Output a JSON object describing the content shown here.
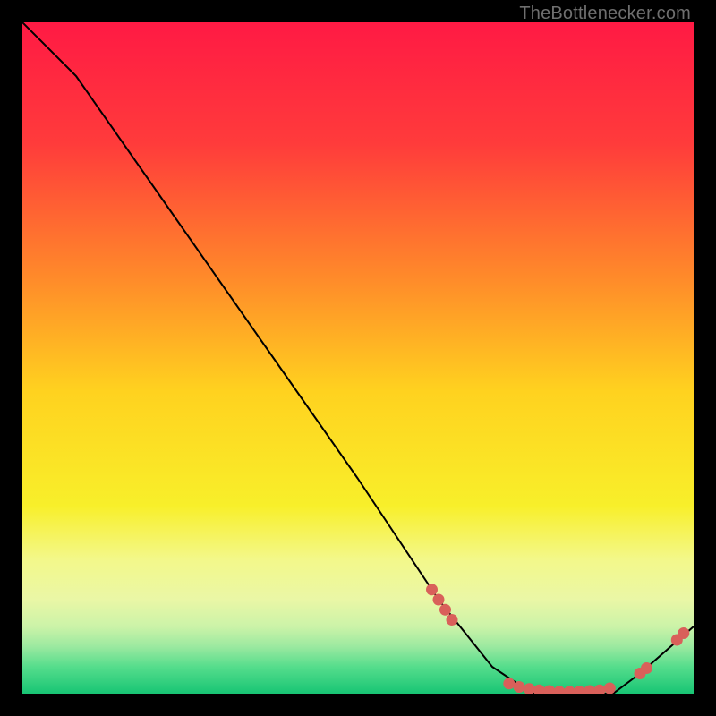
{
  "attribution": "TheBottlenecker.com",
  "chart_data": {
    "type": "line",
    "title": "",
    "xlabel": "",
    "ylabel": "",
    "xlim": [
      0,
      100
    ],
    "ylim": [
      0,
      100
    ],
    "grid": false,
    "legend": false,
    "series": [
      {
        "name": "curve",
        "x": [
          0,
          8,
          22,
          36,
          50,
          62,
          70,
          76,
          82,
          88,
          92,
          100
        ],
        "y": [
          100,
          92,
          72,
          52,
          32,
          14,
          4,
          0,
          0,
          0,
          3,
          10
        ]
      }
    ],
    "markers": {
      "name": "red-dots",
      "points": [
        {
          "x": 61.0,
          "y": 15.5
        },
        {
          "x": 62.0,
          "y": 14.0
        },
        {
          "x": 63.0,
          "y": 12.5
        },
        {
          "x": 64.0,
          "y": 11.0
        },
        {
          "x": 72.5,
          "y": 1.5
        },
        {
          "x": 74.0,
          "y": 1.0
        },
        {
          "x": 75.5,
          "y": 0.7
        },
        {
          "x": 77.0,
          "y": 0.5
        },
        {
          "x": 78.5,
          "y": 0.4
        },
        {
          "x": 80.0,
          "y": 0.3
        },
        {
          "x": 81.5,
          "y": 0.3
        },
        {
          "x": 83.0,
          "y": 0.3
        },
        {
          "x": 84.5,
          "y": 0.4
        },
        {
          "x": 86.0,
          "y": 0.5
        },
        {
          "x": 87.5,
          "y": 0.8
        },
        {
          "x": 92.0,
          "y": 3.0
        },
        {
          "x": 93.0,
          "y": 3.8
        },
        {
          "x": 97.5,
          "y": 8.0
        },
        {
          "x": 98.5,
          "y": 9.0
        }
      ]
    },
    "gradient_stops": [
      {
        "pct": 0,
        "color": "#ff1a44"
      },
      {
        "pct": 18,
        "color": "#ff3b3b"
      },
      {
        "pct": 38,
        "color": "#ff8a2a"
      },
      {
        "pct": 55,
        "color": "#ffd21f"
      },
      {
        "pct": 72,
        "color": "#f8ef2a"
      },
      {
        "pct": 80,
        "color": "#f3f88a"
      },
      {
        "pct": 86,
        "color": "#eaf7a6"
      },
      {
        "pct": 90,
        "color": "#ccf3a8"
      },
      {
        "pct": 93,
        "color": "#9be9a0"
      },
      {
        "pct": 96,
        "color": "#55dd8c"
      },
      {
        "pct": 100,
        "color": "#18c574"
      }
    ],
    "marker_color": "#d9605a",
    "line_color": "#000000",
    "line_width": 2
  }
}
